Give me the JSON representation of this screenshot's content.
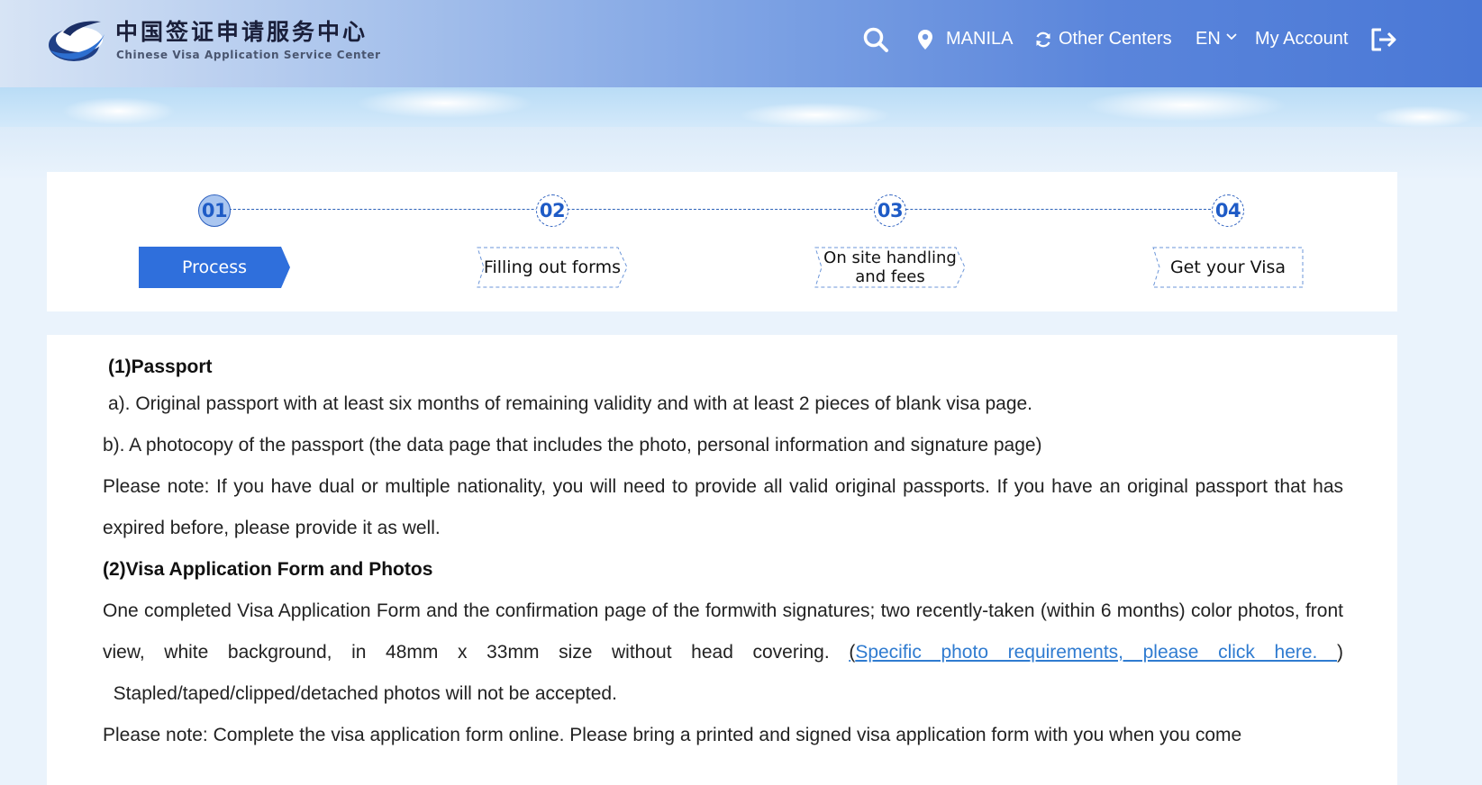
{
  "header": {
    "logo_cn": "中国签证申请服务中心",
    "logo_en": "Chinese Visa Application Service Center",
    "location": "MANILA",
    "other_centers": "Other Centers",
    "language": "EN",
    "account": "My Account",
    "icons": [
      "search-icon",
      "location-pin-icon",
      "refresh-icon",
      "chevron-down-icon",
      "logout-icon"
    ],
    "gradient_colors": [
      "#d7e4f5",
      "#4a78d6"
    ]
  },
  "steps": [
    {
      "number": "01",
      "label": "Process",
      "active": true
    },
    {
      "number": "02",
      "label": "Filling out forms",
      "active": false
    },
    {
      "number": "03",
      "label": "On site handling and fees",
      "label_line1": "On site handling",
      "label_line2": "and fees",
      "active": false
    },
    {
      "number": "04",
      "label": "Get your Visa",
      "active": false
    }
  ],
  "accent_color": "#2f6fdc",
  "content": {
    "passport_heading": "(1)Passport",
    "passport_a": "a). Original passport with at least six months of remaining validity and with at least 2 pieces of blank visa page.",
    "passport_b": "b). A photocopy of the passport (the data page that includes the photo, personal information and signature page)",
    "passport_note": "Please note: If you have dual or multiple nationality, you will need to provide all valid original passports. If you have an original passport that has expired before, please provide it as well.",
    "form_heading": "(2)Visa Application Form and Photos",
    "form_text": "One completed Visa Application Form and the confirmation page of the formwith signatures; two recently-taken (within 6 months) color photos, front view, white background, in 48mm x 33mm size without head covering. ",
    "form_paren_open": "(",
    "form_link": "Specific photo requirements, please click here. ",
    "form_paren_close": ")",
    "form_after": "  Stapled/taped/clipped/detached photos will not be accepted.",
    "form_note": "Please note: Complete the visa application form online. Please bring a printed and signed visa application form with you when you come"
  }
}
